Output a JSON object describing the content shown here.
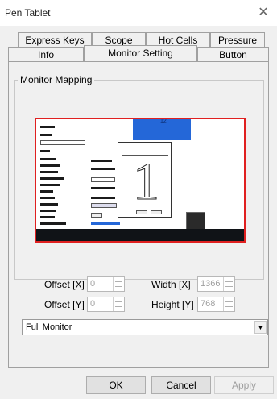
{
  "window": {
    "title": "Pen Tablet"
  },
  "tabs_top": [
    "Express Keys",
    "Scope",
    "Hot Cells",
    "Pressure"
  ],
  "tabs_bottom": [
    "Info",
    "Monitor Setting",
    "Button"
  ],
  "active_tab": "Monitor Setting",
  "group": {
    "label": "Monitor Mapping"
  },
  "preview": {
    "big_digit": "1",
    "blue_mark": "12"
  },
  "offset_x": {
    "label": "Offset [X]",
    "value": "0"
  },
  "offset_y": {
    "label": "Offset [Y]",
    "value": "0"
  },
  "width": {
    "label": "Width [X]",
    "value": "1366"
  },
  "height": {
    "label": "Height [Y]",
    "value": "768"
  },
  "monitor_select": {
    "value": "Full Monitor"
  },
  "buttons": {
    "ok": "OK",
    "cancel": "Cancel",
    "apply": "Apply"
  },
  "colors": {
    "preview_border": "#e02020",
    "highlight_blue": "#2467d8"
  }
}
